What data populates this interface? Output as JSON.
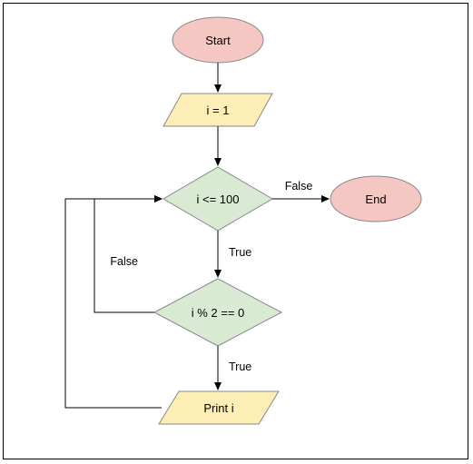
{
  "flowchart": {
    "nodes": {
      "start": "Start",
      "init": "i = 1",
      "cond1": "i <= 100",
      "cond2": "i % 2 == 0",
      "print": "Print i",
      "end": "End"
    },
    "edges": {
      "cond1_true": "True",
      "cond1_false": "False",
      "cond2_true": "True",
      "cond2_false": "False"
    }
  },
  "colors": {
    "terminator": "#f4c7c3",
    "io": "#fdeeb5",
    "decision": "#d9ead3",
    "stroke": "#888888"
  }
}
